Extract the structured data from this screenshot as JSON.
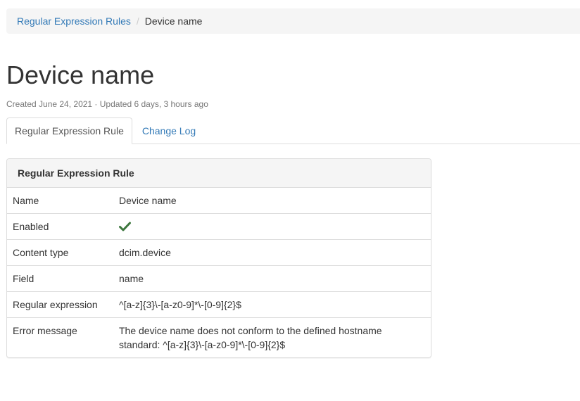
{
  "breadcrumb": {
    "parent": "Regular Expression Rules",
    "separator": "/",
    "current": "Device name"
  },
  "page": {
    "title": "Device name",
    "meta": "Created June 24, 2021 · Updated 6 days, 3 hours ago"
  },
  "tabs": [
    {
      "label": "Regular Expression Rule",
      "active": true
    },
    {
      "label": "Change Log",
      "active": false
    }
  ],
  "panel": {
    "heading": "Regular Expression Rule",
    "rows": [
      {
        "key": "Name",
        "value": "Device name"
      },
      {
        "key": "Enabled",
        "value_icon": "check-icon",
        "value_bool": true
      },
      {
        "key": "Content type",
        "value": "dcim.device"
      },
      {
        "key": "Field",
        "value": "name"
      },
      {
        "key": "Regular expression",
        "value": "^[a-z]{3}\\-[a-z0-9]*\\-[0-9]{2}$"
      },
      {
        "key": "Error message",
        "value": "The device name does not conform to the defined hostname standard: ^[a-z]{3}\\-[a-z0-9]*\\-[0-9]{2}$"
      }
    ]
  },
  "colors": {
    "link": "#337ab7",
    "success": "#3c763d",
    "muted": "#777777"
  }
}
